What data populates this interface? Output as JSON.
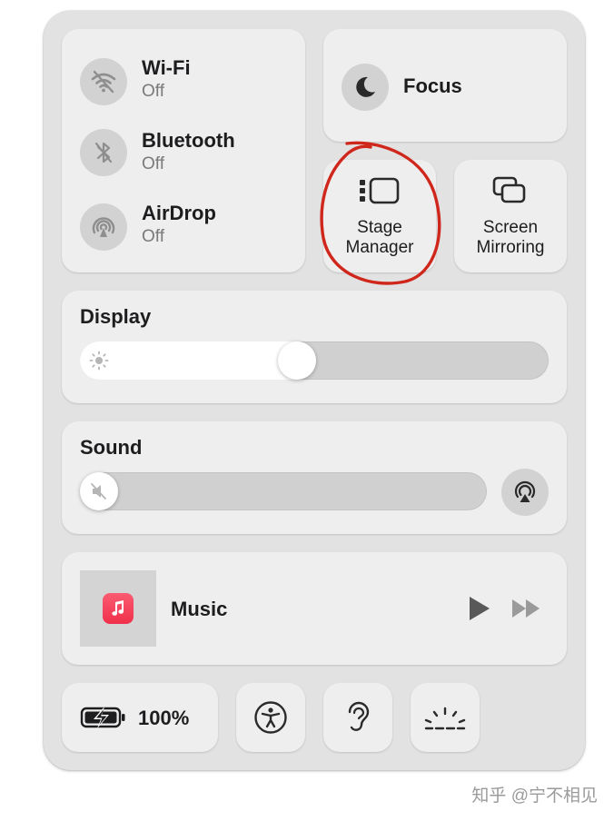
{
  "connectivity": {
    "wifi": {
      "label": "Wi-Fi",
      "status": "Off"
    },
    "bluetooth": {
      "label": "Bluetooth",
      "status": "Off"
    },
    "airdrop": {
      "label": "AirDrop",
      "status": "Off"
    }
  },
  "focus": {
    "label": "Focus"
  },
  "stage_manager": {
    "label_line1": "Stage",
    "label_line2": "Manager"
  },
  "screen_mirroring": {
    "label_line1": "Screen",
    "label_line2": "Mirroring"
  },
  "display": {
    "title": "Display",
    "brightness_fraction": 0.46
  },
  "sound": {
    "title": "Sound",
    "volume_fraction": 0.0
  },
  "now_playing": {
    "app": "Music"
  },
  "battery": {
    "percent_label": "100%"
  },
  "watermark": "知乎 @宁不相见",
  "colors": {
    "annotation_circle": "#d0271d",
    "music_icon": "#f5405a"
  }
}
